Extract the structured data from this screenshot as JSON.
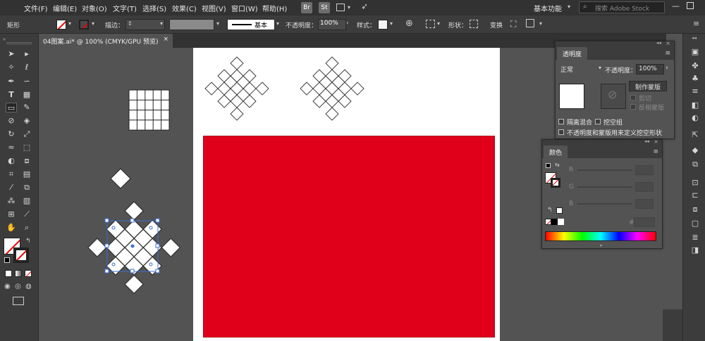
{
  "menubar": {
    "items": [
      "文件(F)",
      "编辑(E)",
      "对象(O)",
      "文字(T)",
      "选择(S)",
      "效果(C)",
      "视图(V)",
      "窗口(W)",
      "帮助(H)"
    ],
    "bridge_label": "Br",
    "stock_label": "St",
    "workspace": "基本功能",
    "search_placeholder": "搜索 Adobe Stock"
  },
  "controlbar": {
    "object_type": "矩形",
    "stroke_label": "描边：",
    "stroke_profile": "基本",
    "opacity_label": "不透明度：",
    "opacity_value": "100%",
    "style_label": "样式：",
    "shape_label": "形状：",
    "transform_label": "变换"
  },
  "document_tab": {
    "title": "04图案.ai* @ 100% (CMYK/GPU 预览)",
    "close": "×"
  },
  "transparency_panel": {
    "title": "透明度",
    "blend_mode": "正常",
    "opacity_label": "不透明度：",
    "opacity_value": "100%",
    "make_mask_button": "制作蒙版",
    "clip_label": "剪切",
    "invert_mask_label": "反相蒙版",
    "isolate_blending": "隔离混合",
    "knockout_group": "挖空组",
    "opacity_mask_define_knockout": "不透明度和蒙版用来定义挖空形状"
  },
  "color_panel": {
    "title": "颜色",
    "channels": [
      "R",
      "G",
      "B"
    ],
    "hex_label": "#"
  },
  "colors": {
    "red_rect": "#e0001a",
    "ui_dark": "#323232",
    "ui_mid": "#3c3c3c",
    "canvas_bg": "#535353",
    "selection": "#3d6fd1"
  },
  "icons": {
    "tools": [
      "selection-icon",
      "direct-selection-icon",
      "magic-wand-icon",
      "lasso-icon",
      "pen-icon",
      "curvature-icon",
      "type-icon",
      "grid-icon",
      "rectangle-icon",
      "brush-icon",
      "shaper-icon",
      "eraser-icon",
      "rotate-icon",
      "scale-icon",
      "width-icon",
      "free-transform-icon",
      "shape-builder-icon",
      "perspective-icon",
      "mesh-icon",
      "gradient-icon",
      "eyedropper-icon",
      "blend-icon",
      "symbol-sprayer-icon",
      "column-graph-icon",
      "artboard-icon",
      "slice-icon",
      "hand-icon",
      "zoom-icon"
    ]
  }
}
